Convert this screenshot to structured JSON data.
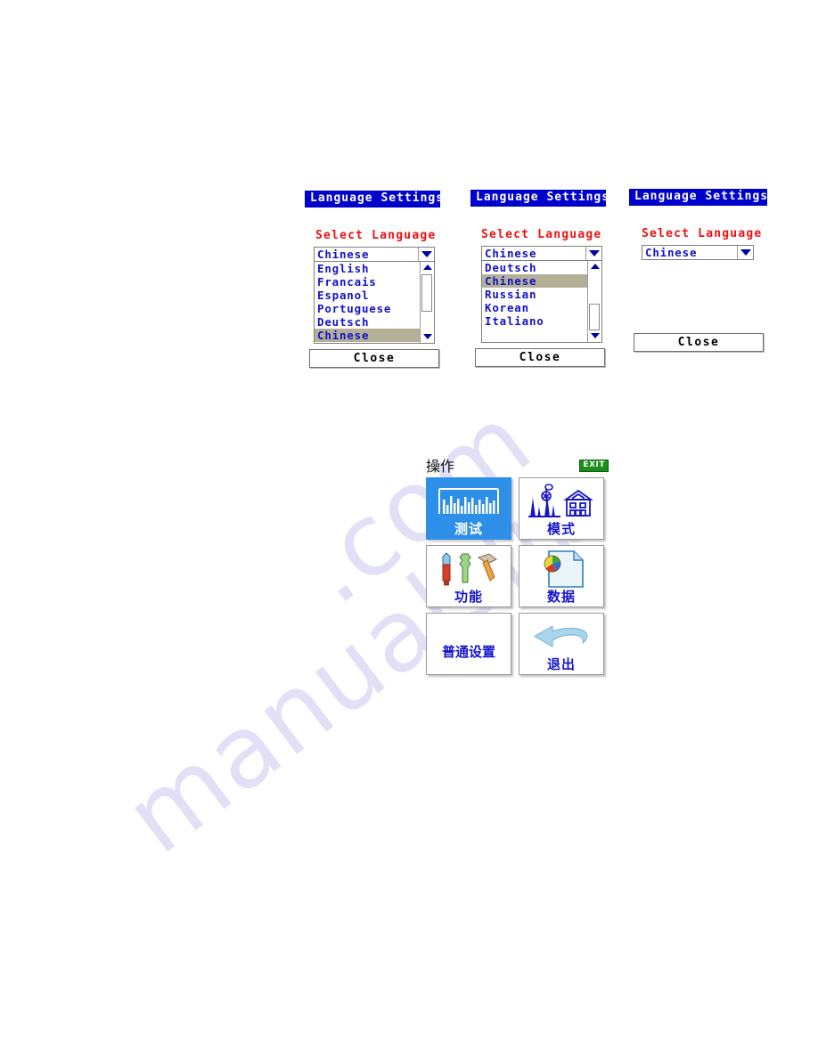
{
  "watermark": {
    "line1": "manualslib",
    "line2": ".com"
  },
  "panels": [
    {
      "title": "Language Settings",
      "select_label": "Select Language",
      "combo_value": "Chinese",
      "dropdown_open": true,
      "options": [
        "English",
        "Francais",
        "Espanol",
        "Portuguese",
        "Deutsch",
        "Chinese"
      ],
      "selected_option": "Chinese",
      "scroll_position": "top",
      "close_label": "Close"
    },
    {
      "title": "Language Settings",
      "select_label": "Select Language",
      "combo_value": "Chinese",
      "dropdown_open": true,
      "options": [
        "Deutsch",
        "Chinese",
        "Russian",
        "Korean",
        "Italiano"
      ],
      "selected_option": "Chinese",
      "scroll_position": "bottom",
      "close_label": "Close"
    },
    {
      "title": "Language Settings",
      "select_label": "Select Language",
      "combo_value": "Chinese",
      "dropdown_open": false,
      "options": [],
      "selected_option": "Chinese",
      "scroll_position": "none",
      "close_label": "Close"
    }
  ],
  "menu": {
    "header_title": "操作",
    "exit_badge": "EXIT",
    "tiles": [
      {
        "label": "测试",
        "icon": "bar-chart-icon",
        "active": true
      },
      {
        "label": "模式",
        "icon": "mode-factory-icon",
        "active": false
      },
      {
        "label": "功能",
        "icon": "tools-icon",
        "active": false
      },
      {
        "label": "数据",
        "icon": "data-document-icon",
        "active": false
      },
      {
        "label": "普通设置",
        "icon": "none",
        "active": false
      },
      {
        "label": "退出",
        "icon": "back-arrow-icon",
        "active": false
      }
    ]
  },
  "colors": {
    "titlebar_blue": "#0000cc",
    "label_red": "#ee1111",
    "text_blue": "#1414c8",
    "highlight_gray": "#b4b098",
    "active_tile_blue": "#2e8fe8",
    "exit_green": "#1a8f1a"
  }
}
